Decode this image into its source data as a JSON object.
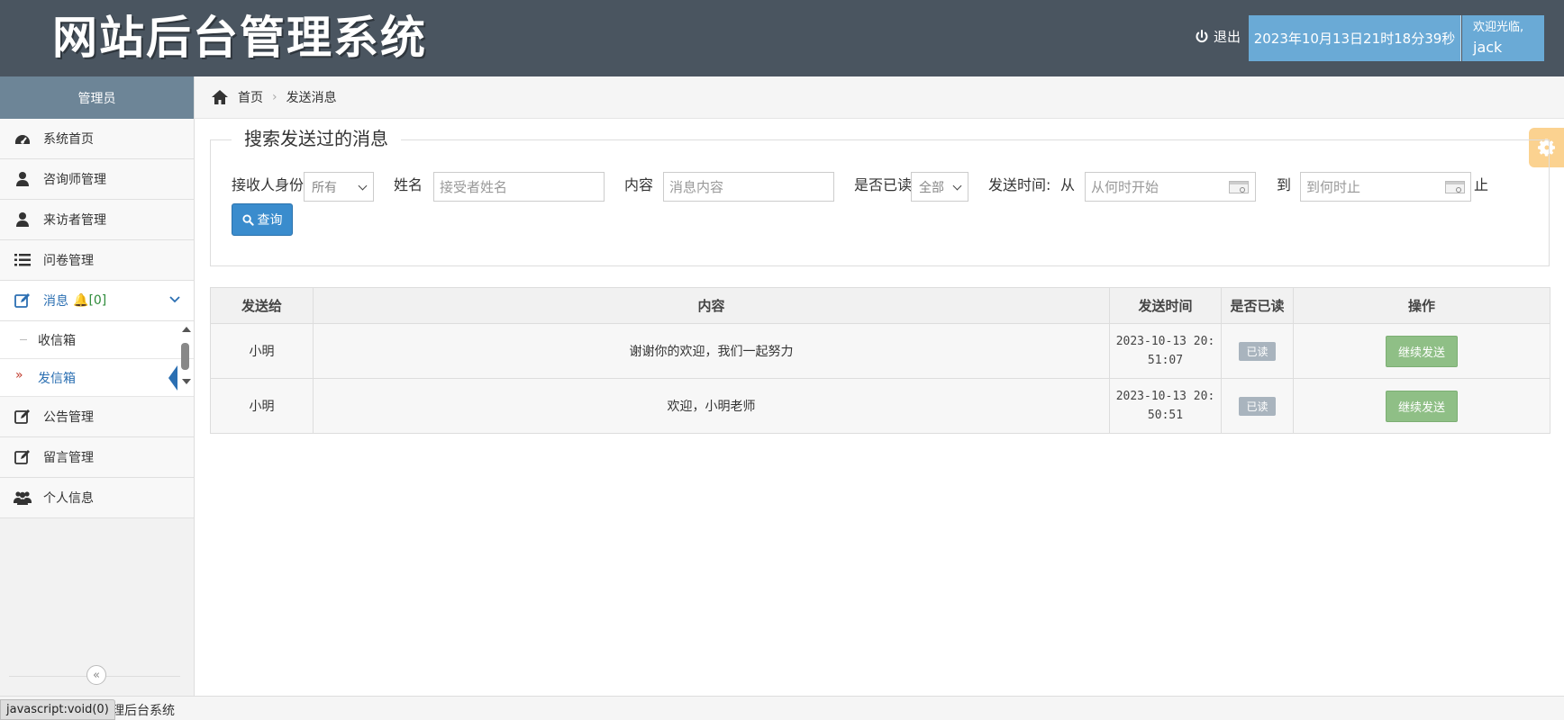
{
  "header": {
    "title": "网站后台管理系统",
    "logout": "退出",
    "datetime": "2023年10月13日21时18分39秒",
    "welcome": "欢迎光临,",
    "username": "jack"
  },
  "sidebar": {
    "title": "管理员",
    "items": [
      {
        "label": "系统首页",
        "icon": "dashboard-icon"
      },
      {
        "label": "咨询师管理",
        "icon": "user-icon"
      },
      {
        "label": "来访者管理",
        "icon": "user-icon"
      },
      {
        "label": "问卷管理",
        "icon": "list-icon"
      },
      {
        "label": "消息",
        "badge": "[0]",
        "icon": "edit-icon"
      },
      {
        "label": "公告管理",
        "icon": "edit-icon"
      },
      {
        "label": "留言管理",
        "icon": "edit-icon"
      },
      {
        "label": "个人信息",
        "icon": "users-icon"
      }
    ],
    "sub_items": [
      {
        "label": "收信箱"
      },
      {
        "label": "发信箱"
      }
    ],
    "collapse": "«"
  },
  "breadcrumb": {
    "home": "首页",
    "current": "发送消息"
  },
  "search": {
    "legend": "搜索发送过的消息",
    "recipient_label": "接收人身份",
    "recipient_value": "所有",
    "name_label": "姓名",
    "name_placeholder": "接受者姓名",
    "content_label": "内容",
    "content_placeholder": "消息内容",
    "read_label": "是否已读",
    "read_value": "全部",
    "time_label": "发送时间:",
    "from_label": "从",
    "from_placeholder": "从何时开始",
    "to_label": "到",
    "to_placeholder": "到何时止",
    "end_label": "止",
    "button": "查询"
  },
  "table": {
    "headers": [
      "发送给",
      "内容",
      "发送时间",
      "是否已读",
      "操作"
    ],
    "rows": [
      {
        "to": "小明",
        "content": "谢谢你的欢迎，我们一起努力",
        "time_date": "2023-10-13 20:",
        "time_clock": "51:07",
        "status": "已读",
        "action": "继续发送"
      },
      {
        "to": "小明",
        "content": "欢迎，小明老师",
        "time_date": "2023-10-13 20:",
        "time_clock": "50:51",
        "status": "已读",
        "action": "继续发送"
      }
    ]
  },
  "footer": {
    "text": "管理后台系统",
    "status_url": "javascript:void(0)"
  },
  "colors": {
    "header_bg": "#4a5560",
    "accent": "#6aaad6",
    "primary_button": "#3a8ccd",
    "resend_button": "#8fbf86"
  }
}
